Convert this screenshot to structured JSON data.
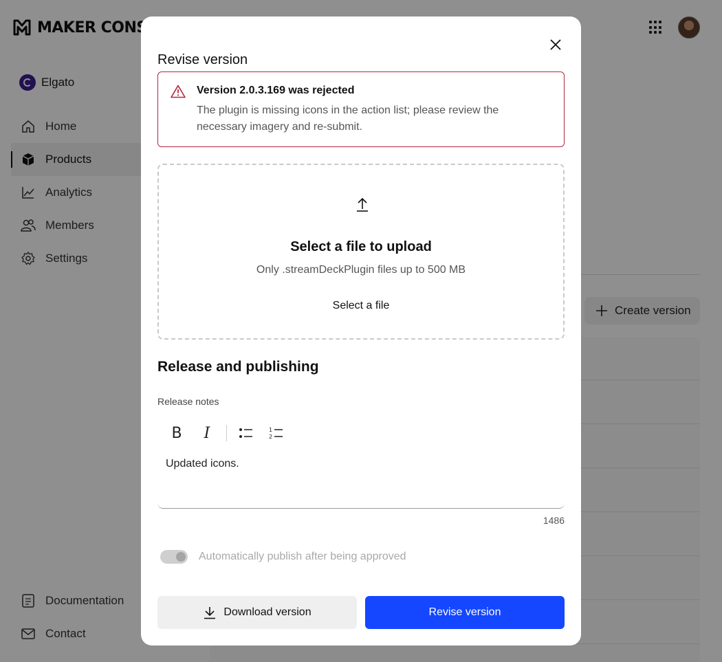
{
  "app": {
    "brand": "MAKER CONSOLE",
    "org_name": "Elgato",
    "nav": [
      {
        "label": "Home",
        "icon": "home-icon"
      },
      {
        "label": "Products",
        "icon": "box-icon",
        "active": true
      },
      {
        "label": "Analytics",
        "icon": "chart-icon"
      },
      {
        "label": "Members",
        "icon": "users-icon"
      },
      {
        "label": "Settings",
        "icon": "gear-icon"
      }
    ],
    "nav_bottom": [
      {
        "label": "Documentation",
        "icon": "document-icon"
      },
      {
        "label": "Contact",
        "icon": "mail-icon"
      }
    ],
    "create_version_label": "Create version"
  },
  "modal": {
    "title": "Revise version",
    "alert": {
      "title": "Version 2.0.3.169 was rejected",
      "body": "The plugin is missing icons in the action list; please review the necessary imagery and re-submit.",
      "color": "#b3263e"
    },
    "upload": {
      "title": "Select a file to upload",
      "subtitle": "Only .streamDeckPlugin files up to 500 MB",
      "link": "Select a file"
    },
    "section_title": "Release and publishing",
    "release_notes": {
      "label": "Release notes",
      "value": "Updated icons.",
      "char_count": "1486",
      "toolbar": [
        "bold-icon",
        "italic-icon",
        "bullet-list-icon",
        "numbered-list-icon"
      ]
    },
    "auto_publish": {
      "label": "Automatically publish after being approved",
      "enabled": true,
      "disabled": true
    },
    "buttons": {
      "download": "Download version",
      "revise": "Revise version",
      "primary_color": "#1447ff"
    }
  }
}
